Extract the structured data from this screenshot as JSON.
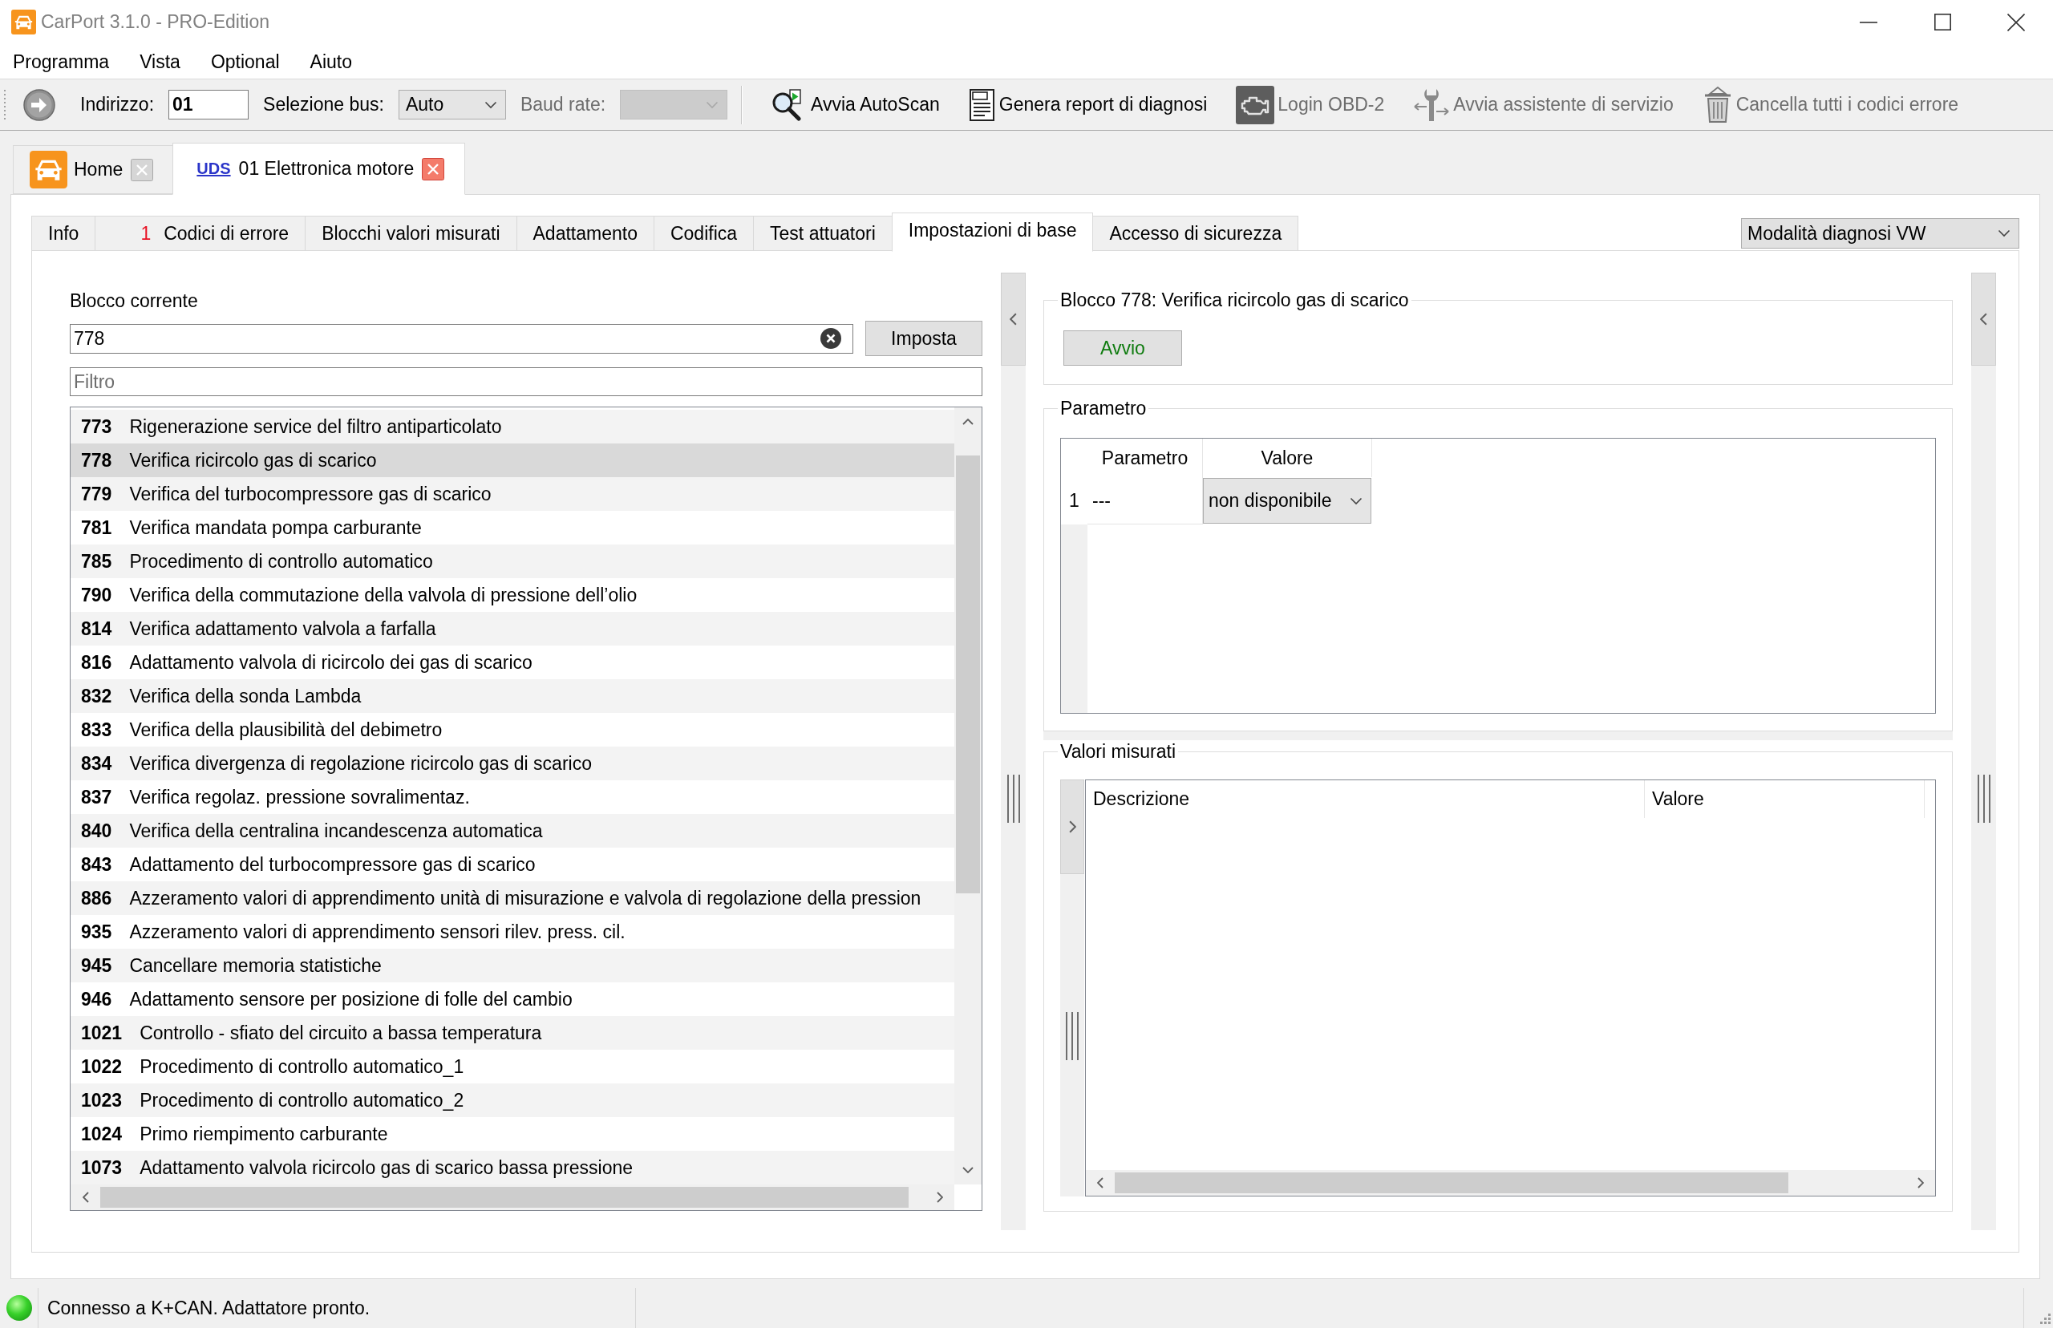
{
  "window": {
    "title": "CarPort 3.1.0 - PRO-Edition"
  },
  "menu": [
    "Programma",
    "Vista",
    "Optional",
    "Aiuto"
  ],
  "toolbar": {
    "address": {
      "label": "Indirizzo:",
      "value": "01"
    },
    "bus": {
      "label": "Selezione bus:",
      "value": "Auto"
    },
    "baud_rate": {
      "label": "Baud rate:",
      "disabled": true
    },
    "actions": [
      {
        "kind": "autoscan",
        "label": "Avvia AutoScan",
        "disabled": false
      },
      {
        "kind": "report",
        "label": "Genera report di diagnosi",
        "disabled": false
      },
      {
        "kind": "login",
        "label": "Login OBD-2",
        "disabled": true
      },
      {
        "kind": "assistant",
        "label": "Avvia assistente di servizio",
        "disabled": true
      },
      {
        "kind": "clear",
        "label": "Cancella tutti i codici errore",
        "disabled": true
      }
    ]
  },
  "document_tabs": [
    {
      "kind": "home",
      "label": "Home",
      "selected": false
    },
    {
      "kind": "module",
      "badge": "UDS",
      "label": "01 Elettronica motore",
      "selected": true
    }
  ],
  "tabs": [
    {
      "label": "Info",
      "selected": false
    },
    {
      "count": "1",
      "label": "Codici di errore",
      "selected": false
    },
    {
      "label": "Blocchi valori misurati",
      "selected": false
    },
    {
      "label": "Adattamento",
      "selected": false
    },
    {
      "label": "Codifica",
      "selected": false
    },
    {
      "label": "Test attuatori",
      "selected": false
    },
    {
      "label": "Impostazioni di base",
      "selected": true
    },
    {
      "label": "Accesso di sicurezza",
      "selected": false
    }
  ],
  "mode_select": {
    "value": "Modalità diagnosi VW"
  },
  "current_block": {
    "label": "Blocco corrente",
    "value": "778",
    "button": "Imposta"
  },
  "filter": {
    "placeholder": "Filtro"
  },
  "blocks": [
    {
      "number": "773",
      "name": "Rigenerazione service del filtro antiparticolato",
      "selected": false
    },
    {
      "number": "778",
      "name": "Verifica ricircolo gas di scarico",
      "selected": true
    },
    {
      "number": "779",
      "name": "Verifica del turbocompressore gas di scarico",
      "selected": false
    },
    {
      "number": "781",
      "name": "Verifica mandata pompa carburante",
      "selected": false
    },
    {
      "number": "785",
      "name": "Procedimento di controllo automatico",
      "selected": false
    },
    {
      "number": "790",
      "name": "Verifica della commutazione della valvola di pressione dell’olio",
      "selected": false
    },
    {
      "number": "814",
      "name": "Verifica adattamento valvola a farfalla",
      "selected": false
    },
    {
      "number": "816",
      "name": "Adattamento valvola di ricircolo dei gas di scarico",
      "selected": false
    },
    {
      "number": "832",
      "name": "Verifica della sonda Lambda",
      "selected": false
    },
    {
      "number": "833",
      "name": "Verifica della plausibilità del debimetro",
      "selected": false
    },
    {
      "number": "834",
      "name": "Verifica divergenza di regolazione ricircolo gas di scarico",
      "selected": false
    },
    {
      "number": "837",
      "name": "Verifica regolaz. pressione sovralimentaz.",
      "selected": false
    },
    {
      "number": "840",
      "name": "Verifica della centralina incandescenza automatica",
      "selected": false
    },
    {
      "number": "843",
      "name": "Adattamento del turbocompressore gas di scarico",
      "selected": false
    },
    {
      "number": "886",
      "name": "Azzeramento valori di apprendimento unità di misurazione e valvola di regolazione della pression",
      "selected": false
    },
    {
      "number": "935",
      "name": "Azzeramento valori di apprendimento sensori rilev. press. cil.",
      "selected": false
    },
    {
      "number": "945",
      "name": "Cancellare memoria statistiche",
      "selected": false
    },
    {
      "number": "946",
      "name": "Adattamento sensore per posizione di folle del cambio",
      "selected": false
    },
    {
      "number": "1021",
      "name": "Controllo - sfiato del circuito a bassa temperatura",
      "selected": false
    },
    {
      "number": "1022",
      "name": "Procedimento di controllo automatico_1",
      "selected": false
    },
    {
      "number": "1023",
      "name": "Procedimento di controllo automatico_2",
      "selected": false
    },
    {
      "number": "1024",
      "name": "Primo riempimento carburante",
      "selected": false
    },
    {
      "number": "1073",
      "name": "Adattamento valvola ricircolo gas di scarico bassa pressione",
      "selected": false
    }
  ],
  "block_group": {
    "title": "Blocco 778: Verifica ricircolo gas di scarico",
    "button": "Avvio"
  },
  "parameter_group": {
    "title": "Parametro",
    "columns": [
      "Parametro",
      "Valore"
    ],
    "rows": [
      {
        "number": "1",
        "parameter": "---",
        "value": "non disponibile"
      }
    ]
  },
  "measured_group": {
    "title": "Valori misurati",
    "columns": [
      "Descrizione",
      "Valore"
    ]
  },
  "status_bar": {
    "connected": true,
    "text": "Connesso a K+CAN. Adattatore pronto."
  }
}
